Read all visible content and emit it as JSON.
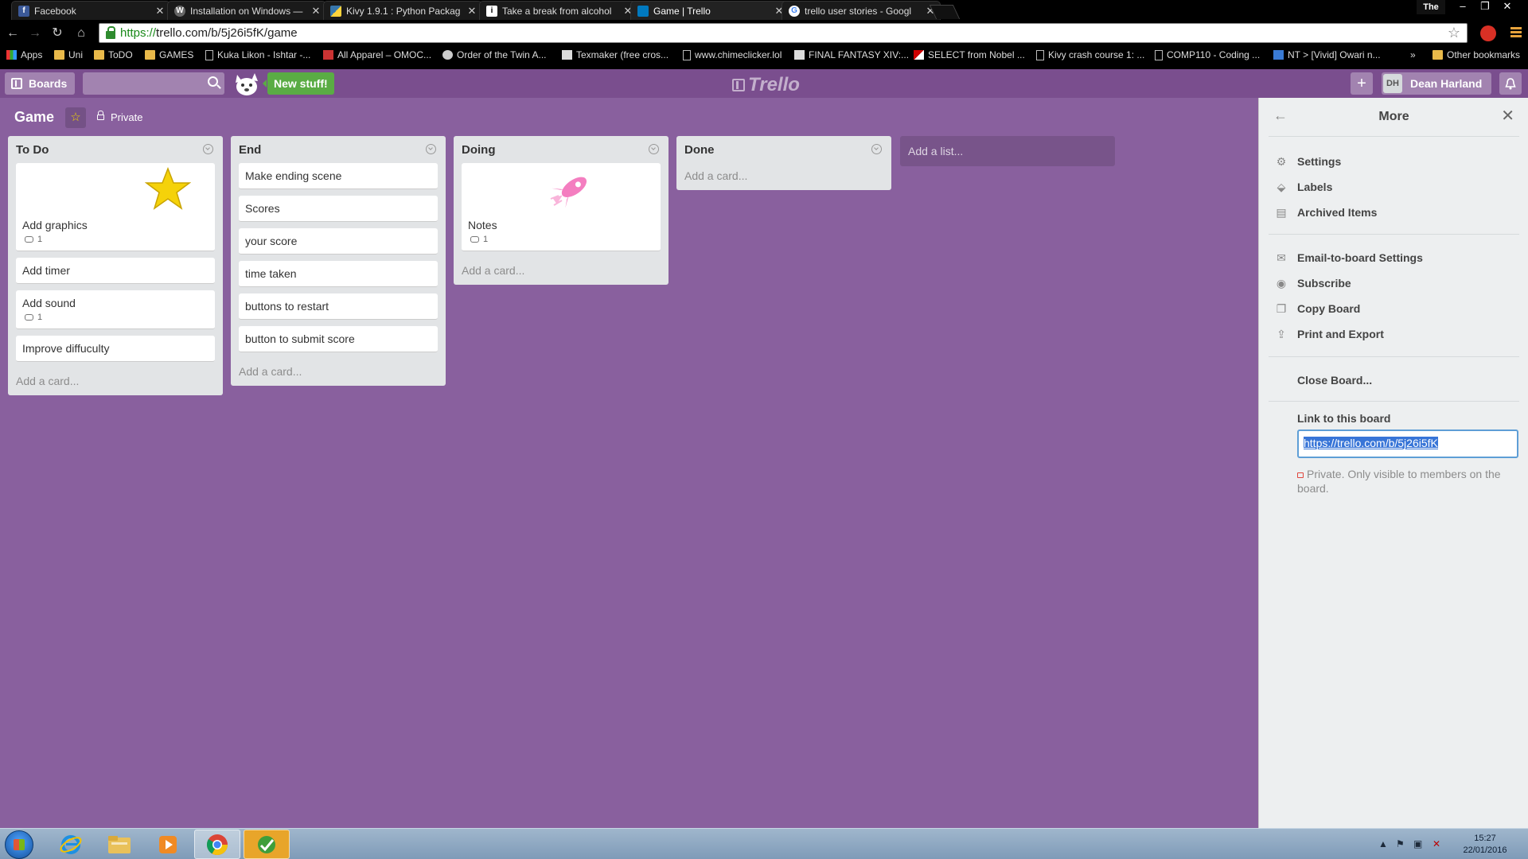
{
  "browser": {
    "tabs": [
      {
        "title": "Facebook",
        "icon": "facebook-icon",
        "color": "#3b5998"
      },
      {
        "title": "Installation on Windows —",
        "icon": "wordpress-icon",
        "color": "#666666"
      },
      {
        "title": "Kivy 1.9.1 : Python Packag",
        "icon": "python-icon",
        "color": "#3776ab"
      },
      {
        "title": "Take a break from alcohol",
        "icon": "info-icon",
        "color": "#ffffff"
      },
      {
        "title": "Game | Trello",
        "icon": "trello-icon",
        "color": "#0079bf"
      },
      {
        "title": "trello user stories - Googl",
        "icon": "google-icon",
        "color": "#ffffff"
      }
    ],
    "user_badge": "The",
    "url_scheme": "https://",
    "url_rest": "trello.com/b/5j26i5fK/game",
    "bookmarks": [
      {
        "label": "Apps",
        "icon": "apps"
      },
      {
        "label": "Uni",
        "icon": "folder"
      },
      {
        "label": "ToDO",
        "icon": "folder"
      },
      {
        "label": "GAMES",
        "icon": "folder"
      },
      {
        "label": "Kuka Likon - Ishtar -...",
        "icon": "page"
      },
      {
        "label": "All Apparel – OMOC...",
        "icon": "sq"
      },
      {
        "label": "Order of the Twin A...",
        "icon": "sq"
      },
      {
        "label": "Texmaker (free cros...",
        "icon": "sq"
      },
      {
        "label": "www.chimeclicker.lol",
        "icon": "page"
      },
      {
        "label": "FINAL FANTASY XIV:...",
        "icon": "sq"
      },
      {
        "label": "SELECT from Nobel ...",
        "icon": "sq"
      },
      {
        "label": "Kivy crash course 1: ...",
        "icon": "page"
      },
      {
        "label": "COMP110 - Coding ...",
        "icon": "page"
      },
      {
        "label": "NT > [Vivid] Owari n...",
        "icon": "sq"
      }
    ],
    "bookmarks_more": "»",
    "other_bookmarks": "Other bookmarks"
  },
  "header": {
    "boards_label": "Boards",
    "new_stuff": "New stuff!",
    "logo": "Trello",
    "add": "+",
    "user_initials": "DH",
    "user_name": "Dean Harland"
  },
  "board": {
    "title": "Game",
    "visibility": "Private",
    "lists": [
      {
        "title": "To Do",
        "cards": [
          {
            "text": "Add graphics",
            "cover": "star",
            "comments": "1"
          },
          {
            "text": "Add timer"
          },
          {
            "text": "Add sound",
            "comments": "1"
          },
          {
            "text": "Improve diffuculty"
          }
        ],
        "add_card": "Add a card..."
      },
      {
        "title": "End",
        "cards": [
          {
            "text": "Make ending scene"
          },
          {
            "text": "Scores"
          },
          {
            "text": "your score"
          },
          {
            "text": "time taken"
          },
          {
            "text": "buttons to restart"
          },
          {
            "text": "button to submit score"
          }
        ],
        "add_card": "Add a card..."
      },
      {
        "title": "Doing",
        "cards": [
          {
            "text": "Notes",
            "cover": "rocket",
            "comments": "1"
          }
        ],
        "add_card": "Add a card..."
      },
      {
        "title": "Done",
        "cards": [],
        "add_card": "Add a card..."
      }
    ],
    "add_list": "Add a list..."
  },
  "sidebar": {
    "title": "More",
    "group1": [
      {
        "label": "Settings",
        "icon": "gear-icon"
      },
      {
        "label": "Labels",
        "icon": "tag-icon"
      },
      {
        "label": "Archived Items",
        "icon": "archive-icon"
      }
    ],
    "group2": [
      {
        "label": "Email-to-board Settings",
        "icon": "email-icon"
      },
      {
        "label": "Subscribe",
        "icon": "eye-icon"
      },
      {
        "label": "Copy Board",
        "icon": "copy-icon"
      },
      {
        "label": "Print and Export",
        "icon": "share-icon"
      }
    ],
    "close_board": "Close Board...",
    "link_label": "Link to this board",
    "link_value": "https://trello.com/b/5j26i5fK",
    "note": "Private. Only visible to members on the board."
  },
  "taskbar": {
    "time": "15:27",
    "date": "22/01/2016"
  },
  "colors": {
    "board_bg": "#89609e",
    "header_bg": "#7a4e8e",
    "new_stuff_green": "#5aac44",
    "list_bg": "#e2e4e6"
  }
}
